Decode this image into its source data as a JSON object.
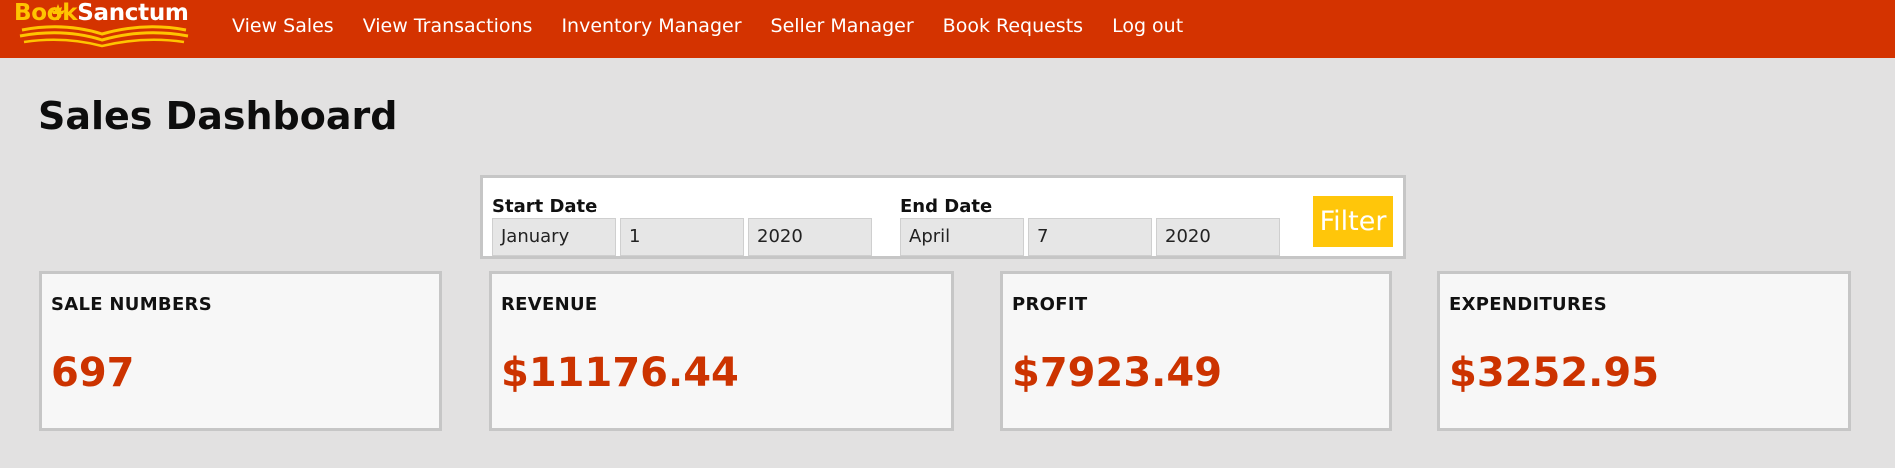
{
  "brand": {
    "part1": "B",
    "part2": "ook",
    "part3": "Sanctum"
  },
  "nav": {
    "items": [
      {
        "label": "View Sales",
        "id": "view-sales"
      },
      {
        "label": "View Transactions",
        "id": "view-transactions"
      },
      {
        "label": "Inventory Manager",
        "id": "inventory-manager"
      },
      {
        "label": "Seller Manager",
        "id": "seller-manager"
      },
      {
        "label": "Book Requests",
        "id": "book-requests"
      },
      {
        "label": "Log out",
        "id": "log-out"
      }
    ]
  },
  "page": {
    "title": "Sales Dashboard"
  },
  "filter": {
    "start": {
      "label": "Start Date",
      "month": "January",
      "day": "1",
      "year": "2020"
    },
    "end": {
      "label": "End Date",
      "month": "April",
      "day": "7",
      "year": "2020"
    },
    "button_label": "Filter"
  },
  "cards": [
    {
      "title": "SALE NUMBERS",
      "value": "697"
    },
    {
      "title": "REVENUE",
      "value": "$11176.44"
    },
    {
      "title": "PROFIT",
      "value": "$7923.49"
    },
    {
      "title": "EXPENDITURES",
      "value": "$3252.95"
    }
  ],
  "colors": {
    "navbar": "#d43300",
    "accent_value": "#cc3300",
    "filter_button": "#ffc60a",
    "logo_yellow": "#ffc400",
    "background": "#e2e1e1"
  },
  "icons": {
    "logo_leaf": "maple-leaf-icon",
    "logo_book": "open-book-icon"
  }
}
